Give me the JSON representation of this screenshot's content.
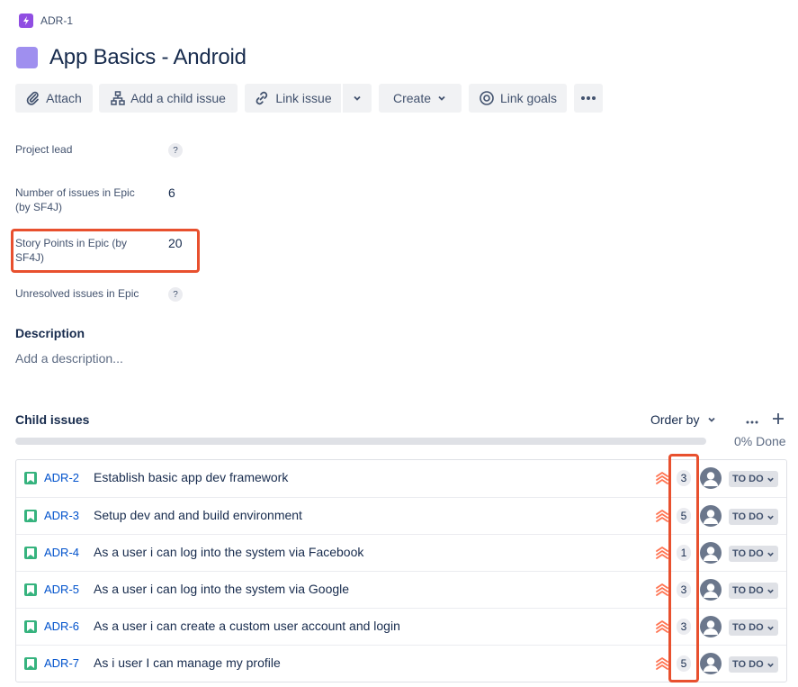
{
  "breadcrumb": {
    "issue_key": "ADR-1",
    "icon": "lightning-icon"
  },
  "page": {
    "title": "App Basics - Android"
  },
  "toolbar": {
    "attach": "Attach",
    "add_child": "Add a child issue",
    "link_issue": "Link issue",
    "create": "Create",
    "link_goals": "Link goals"
  },
  "fields": {
    "project_lead": {
      "label": "Project lead",
      "value": "?"
    },
    "num_issues": {
      "label": "Number of issues in Epic (by SF4J)",
      "value": "6"
    },
    "story_points": {
      "label": "Story Points in Epic (by SF4J)",
      "value": "20"
    },
    "unresolved": {
      "label": "Unresolved issues in Epic",
      "value": "?"
    }
  },
  "description": {
    "heading": "Description",
    "placeholder": "Add a description..."
  },
  "child_issues": {
    "heading": "Child issues",
    "order_by": "Order by",
    "progress_text": "0% Done",
    "progress_fraction": 0,
    "items": [
      {
        "key": "ADR-2",
        "summary": "Establish basic app dev framework",
        "points": "3",
        "status": "TO DO"
      },
      {
        "key": "ADR-3",
        "summary": "Setup dev and and build environment",
        "points": "5",
        "status": "TO DO"
      },
      {
        "key": "ADR-4",
        "summary": "As a user i can log into the system via Facebook",
        "points": "1",
        "status": "TO DO"
      },
      {
        "key": "ADR-5",
        "summary": "As a user i can log into the system via Google",
        "points": "3",
        "status": "TO DO"
      },
      {
        "key": "ADR-6",
        "summary": "As a user i can create a custom user account and login",
        "points": "3",
        "status": "TO DO"
      },
      {
        "key": "ADR-7",
        "summary": "As i user I can manage my profile",
        "points": "5",
        "status": "TO DO"
      }
    ]
  },
  "colors": {
    "highlight": "#e8502e",
    "story": "#36b37e",
    "epic": "#904ee2",
    "link": "#0052cc",
    "priority": "#ff7452"
  }
}
